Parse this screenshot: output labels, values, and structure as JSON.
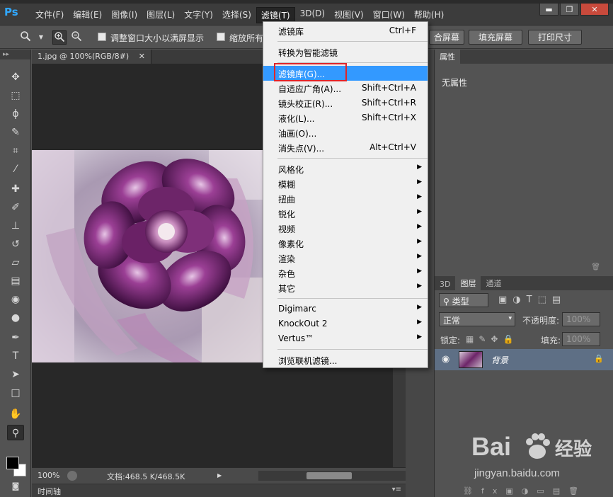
{
  "app": {
    "logo": "Ps"
  },
  "menubar": {
    "items": [
      "文件(F)",
      "编辑(E)",
      "图像(I)",
      "图层(L)",
      "文字(Y)",
      "选择(S)",
      "滤镜(T)",
      "3D(D)",
      "视图(V)",
      "窗口(W)",
      "帮助(H)"
    ],
    "active_index": 6
  },
  "window_controls": {
    "minimize": "▬",
    "maximize": "❐",
    "close": "✕"
  },
  "options_bar": {
    "tool_icon": "zoom-tool-icon",
    "resize_windows_label": "调整窗口大小以满屏显示",
    "zoom_all_label": "缩放所有",
    "fit_screen_label": "合屏幕",
    "fill_screen_label": "填充屏幕",
    "print_size_label": "打印尺寸"
  },
  "document": {
    "tab_title": "1.jpg @ 100%(RGB/8#)",
    "zoom": "100%",
    "doc_info": "文档:468.5 K/468.5K"
  },
  "timeline": {
    "label": "时间轴"
  },
  "filter_menu": {
    "items": [
      {
        "label": "滤镜库",
        "shortcut": "Ctrl+F",
        "submenu": false,
        "highlighted": false,
        "group": 0
      },
      {
        "label": "转换为智能滤镜",
        "shortcut": "",
        "submenu": false,
        "highlighted": false,
        "group": 1
      },
      {
        "label": "滤镜库(G)...",
        "shortcut": "",
        "submenu": false,
        "highlighted": true,
        "group": 2
      },
      {
        "label": "自适应广角(A)...",
        "shortcut": "Shift+Ctrl+A",
        "submenu": false,
        "highlighted": false,
        "group": 2
      },
      {
        "label": "镜头校正(R)...",
        "shortcut": "Shift+Ctrl+R",
        "submenu": false,
        "highlighted": false,
        "group": 2
      },
      {
        "label": "液化(L)...",
        "shortcut": "Shift+Ctrl+X",
        "submenu": false,
        "highlighted": false,
        "group": 2
      },
      {
        "label": "油画(O)...",
        "shortcut": "",
        "submenu": false,
        "highlighted": false,
        "group": 2
      },
      {
        "label": "消失点(V)...",
        "shortcut": "Alt+Ctrl+V",
        "submenu": false,
        "highlighted": false,
        "group": 2
      },
      {
        "label": "风格化",
        "shortcut": "",
        "submenu": true,
        "highlighted": false,
        "group": 3
      },
      {
        "label": "模糊",
        "shortcut": "",
        "submenu": true,
        "highlighted": false,
        "group": 3
      },
      {
        "label": "扭曲",
        "shortcut": "",
        "submenu": true,
        "highlighted": false,
        "group": 3
      },
      {
        "label": "锐化",
        "shortcut": "",
        "submenu": true,
        "highlighted": false,
        "group": 3
      },
      {
        "label": "视频",
        "shortcut": "",
        "submenu": true,
        "highlighted": false,
        "group": 3
      },
      {
        "label": "像素化",
        "shortcut": "",
        "submenu": true,
        "highlighted": false,
        "group": 3
      },
      {
        "label": "渲染",
        "shortcut": "",
        "submenu": true,
        "highlighted": false,
        "group": 3
      },
      {
        "label": "杂色",
        "shortcut": "",
        "submenu": true,
        "highlighted": false,
        "group": 3
      },
      {
        "label": "其它",
        "shortcut": "",
        "submenu": true,
        "highlighted": false,
        "group": 3
      },
      {
        "label": "Digimarc",
        "shortcut": "",
        "submenu": true,
        "highlighted": false,
        "group": 4
      },
      {
        "label": "KnockOut 2",
        "shortcut": "",
        "submenu": true,
        "highlighted": false,
        "group": 4
      },
      {
        "label": "Vertus™",
        "shortcut": "",
        "submenu": true,
        "highlighted": false,
        "group": 4
      },
      {
        "label": "浏览联机滤镜...",
        "shortcut": "",
        "submenu": false,
        "highlighted": false,
        "group": 5
      }
    ],
    "highlight_color": "#3399ff",
    "callout_color": "#e0242a"
  },
  "properties_panel": {
    "tab": "属性",
    "text": "无属性"
  },
  "layers_panel": {
    "tabs": [
      "3D",
      "图层",
      "通道"
    ],
    "active_tab": 1,
    "kind_filter": "类型",
    "blend_mode": "正常",
    "opacity_label": "不透明度:",
    "opacity_value": "100%",
    "lock_label": "锁定:",
    "fill_label": "填充:",
    "fill_value": "100%",
    "layers": [
      {
        "name": "背景",
        "locked": true,
        "visible": true
      }
    ]
  },
  "watermark": {
    "brand": "Bai",
    "brand2": "经验",
    "url": "jingyan.baidu.com"
  },
  "colors": {
    "accent": "#31a8ff",
    "selected_layer": "#5e6f85"
  }
}
